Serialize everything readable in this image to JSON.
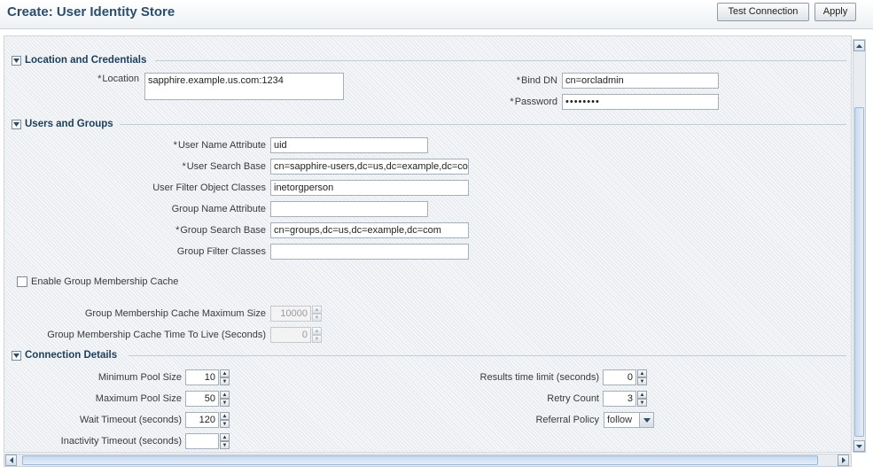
{
  "header": {
    "title": "Create: User Identity Store",
    "test_connection_label": "Test Connection",
    "apply_label": "Apply"
  },
  "location_section": {
    "title": "Location and Credentials",
    "location_label": "Location",
    "location_value": "sapphire.example.us.com:1234",
    "bind_dn_label": "Bind DN",
    "bind_dn_value": "cn=orcladmin",
    "password_label": "Password",
    "password_value": "••••••••"
  },
  "users_section": {
    "title": "Users and Groups",
    "user_name_attr_label": "User Name Attribute",
    "user_name_attr_value": "uid",
    "user_search_base_label": "User Search Base",
    "user_search_base_value": "cn=sapphire-users,dc=us,dc=example,dc=com",
    "user_filter_label": "User Filter Object Classes",
    "user_filter_value": "inetorgperson",
    "group_name_attr_label": "Group Name Attribute",
    "group_name_attr_value": "",
    "group_search_base_label": "Group Search Base",
    "group_search_base_value": "cn=groups,dc=us,dc=example,dc=com",
    "group_filter_label": "Group Filter Classes",
    "group_filter_value": "",
    "enable_cache_label": "Enable Group Membership Cache",
    "enable_cache_checked": false,
    "cache_max_size_label": "Group Membership Cache Maximum Size",
    "cache_max_size_value": "10000",
    "cache_ttl_label": "Group Membership Cache Time To Live (Seconds)",
    "cache_ttl_value": "0"
  },
  "connection_section": {
    "title": "Connection Details",
    "min_pool_label": "Minimum Pool Size",
    "min_pool_value": "10",
    "max_pool_label": "Maximum Pool Size",
    "max_pool_value": "50",
    "wait_timeout_label": "Wait Timeout (seconds)",
    "wait_timeout_value": "120",
    "inactivity_timeout_label": "Inactivity Timeout (seconds)",
    "inactivity_timeout_value": "",
    "results_limit_label": "Results time limit (seconds)",
    "results_limit_value": "0",
    "retry_count_label": "Retry Count",
    "retry_count_value": "3",
    "referral_policy_label": "Referral Policy",
    "referral_policy_value": "follow"
  },
  "icons": {
    "disclose": "disclose-chevron-icon",
    "spin_up": "spin-up-icon",
    "spin_down": "spin-down-icon",
    "scroll_up": "scroll-up-arrow-icon",
    "scroll_down": "scroll-down-arrow-icon",
    "scroll_left": "scroll-left-arrow-icon",
    "scroll_right": "scroll-right-arrow-icon",
    "dropdown": "chevron-down-icon"
  },
  "colors": {
    "title": "#2b4d6a",
    "section_heading": "#1e3d5a",
    "scroll_thumb": "#c7daf0"
  }
}
